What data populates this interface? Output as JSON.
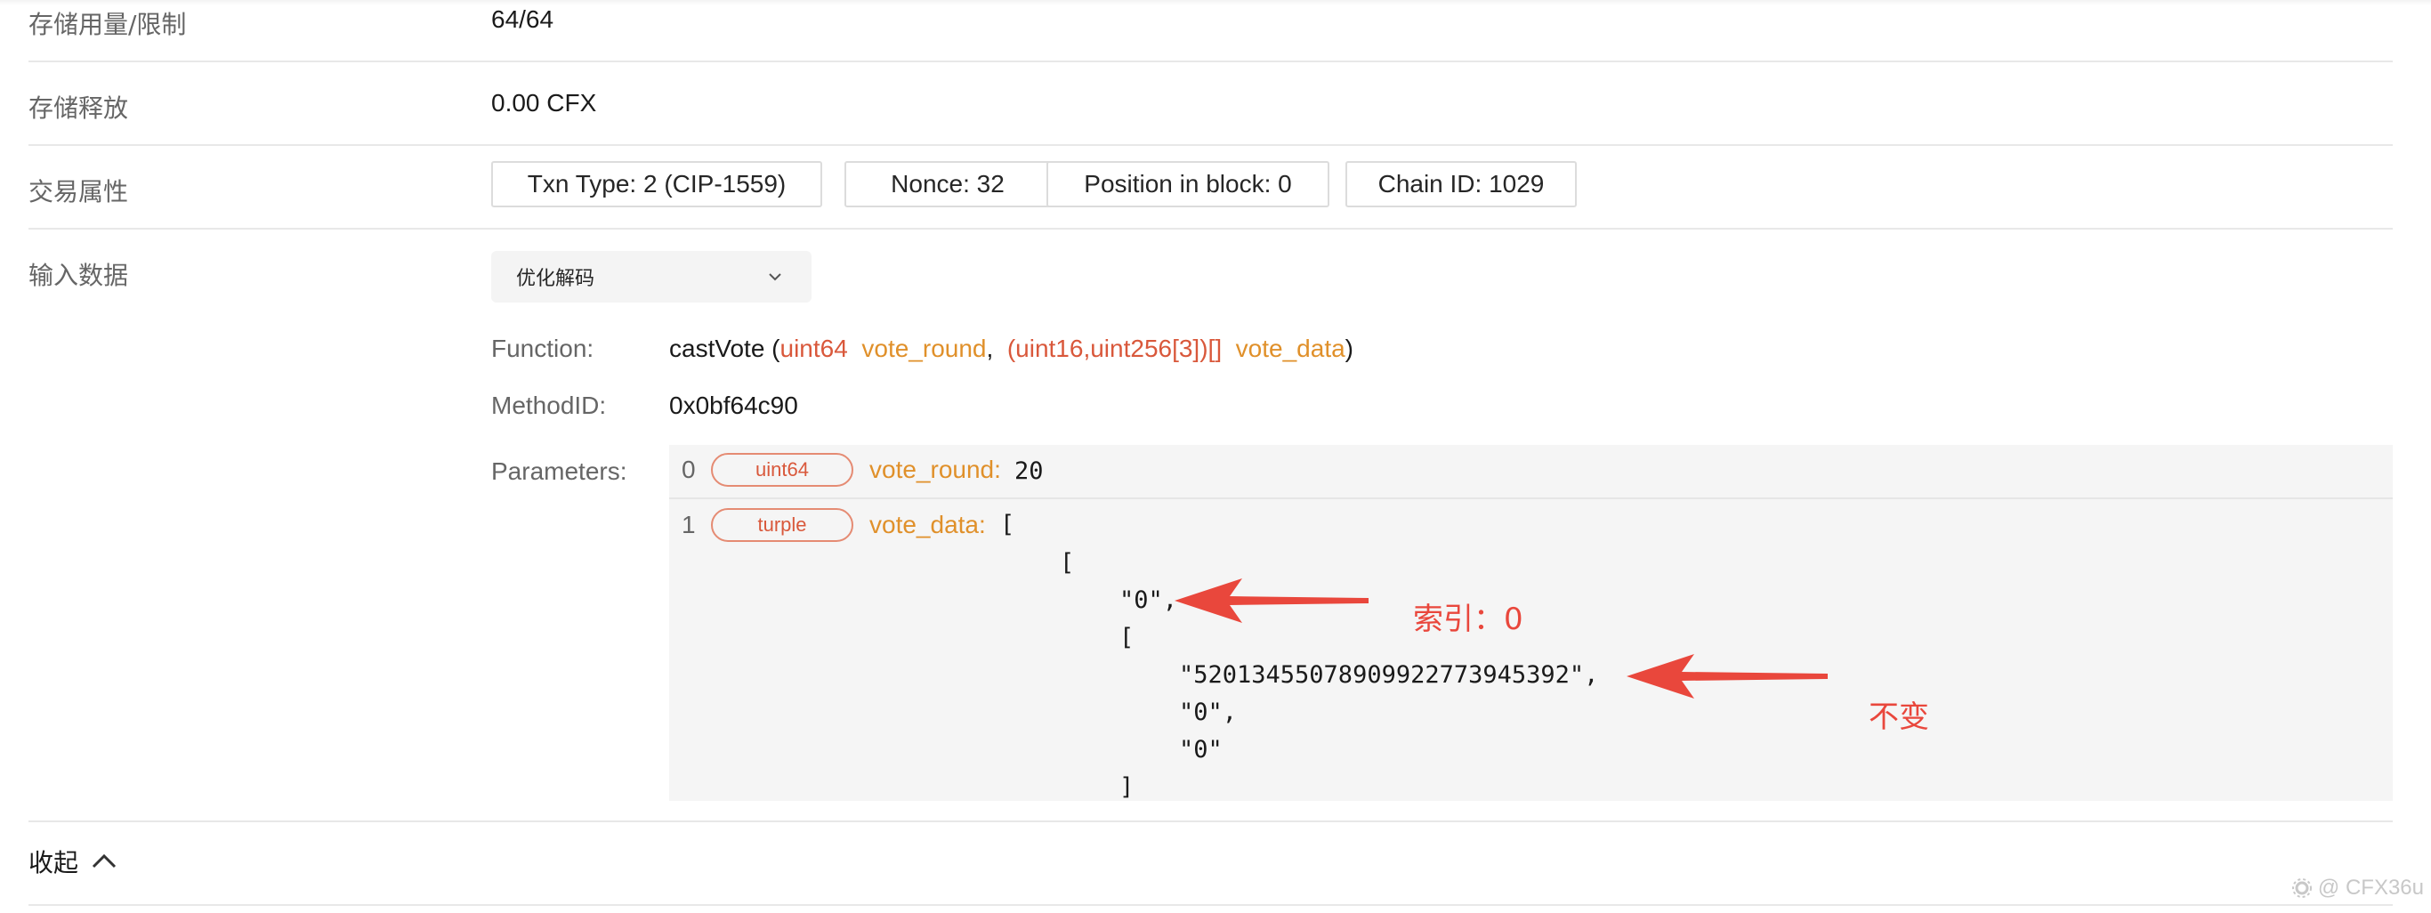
{
  "rows": {
    "storage_usage": {
      "label": "存储用量/限制",
      "value": "64/64"
    },
    "storage_release": {
      "label": "存储释放",
      "value": "0.00 CFX"
    },
    "tx_attributes": {
      "label": "交易属性",
      "tags": [
        "Txn Type: 2 (CIP-1559)",
        "Nonce: 32",
        "Position in block: 0",
        "Chain ID: 1029"
      ]
    },
    "input_data": {
      "label": "输入数据",
      "decode_select": "优化解码"
    }
  },
  "decode": {
    "function_label": "Function:",
    "function": {
      "name": "castVote",
      "open": " (",
      "type1": "uint64",
      "arg1": "vote_round",
      "sep": ",",
      "type2": "(uint16,uint256[3])[]",
      "arg2": "vote_data",
      "close": ")"
    },
    "method_label": "MethodID:",
    "method_id": "0x0bf64c90",
    "params_label": "Parameters:",
    "params": [
      {
        "index": "0",
        "type": "uint64",
        "name": "vote_round:",
        "value": "20"
      },
      {
        "index": "1",
        "type": "turple",
        "name": "vote_data:",
        "value": "["
      }
    ],
    "vote_data_lines": [
      "[",
      "\"0\",",
      "[",
      "\"52013455078909922773945392\",",
      "\"0\",",
      "\"0\"",
      "]"
    ]
  },
  "annotations": {
    "index_note": "索引：0",
    "unchanged_note": "不变"
  },
  "footer": {
    "collapse_label": "收起"
  },
  "watermark": "@ CFX36u",
  "colors": {
    "accent_red": "#e9473c",
    "type_red": "#d9583b",
    "param_orange": "#e0902a"
  }
}
